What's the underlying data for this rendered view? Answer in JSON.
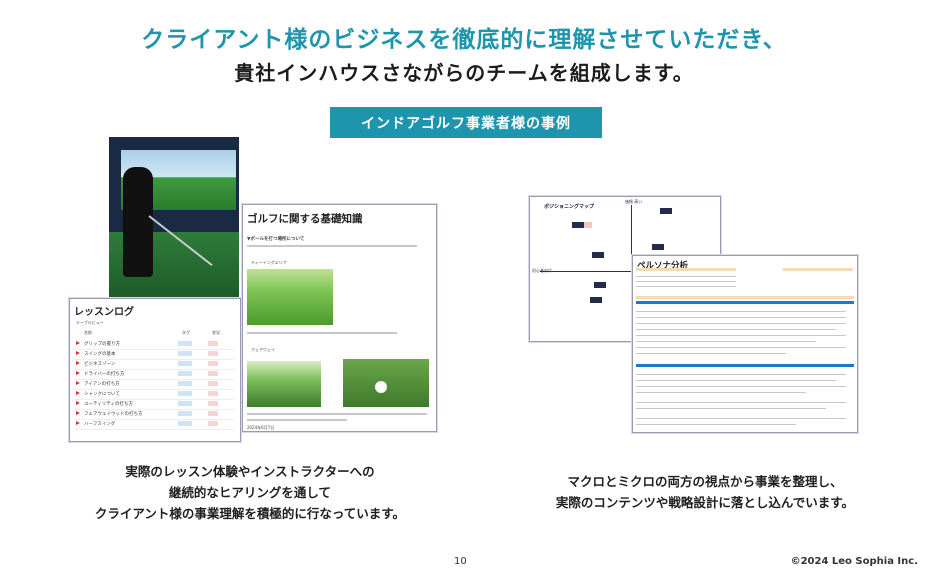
{
  "header": {
    "line1": "クライアント様のビジネスを徹底的に理解させていただき、",
    "line2": "貴社インハウスさながらのチームを組成します。"
  },
  "section_tag": "インドアゴルフ事業者様の事例",
  "left_panel": {
    "knowledge_doc": {
      "title": "ゴルフに関する基礎知識",
      "heading": "▼ボールを打つ場所について",
      "sub1": "ティーイングエリア",
      "sub2": "フェアウェイ",
      "footer": "2024年6月7日"
    },
    "lesson_log": {
      "title": "レッスンログ",
      "view": "テーブルビュー",
      "columns": [
        "名前",
        "タグ",
        "状況"
      ],
      "rows": [
        "グリップの握り方",
        "スイングの基本",
        "ビジネスゾーン",
        "ドライバーの打ち方",
        "アイアンの打ち方",
        "シャンクについて",
        "ユーティリティの打ち方",
        "フェアウェイウッドの打ち方",
        "ハーフスイング"
      ]
    },
    "caption": [
      "実際のレッスン体験やインストラクターへの",
      "継続的なヒアリングを通して",
      "クライアント様の事業理解を積極的に行なっています。"
    ]
  },
  "right_panel": {
    "positioning_map": {
      "title": "ポジショニングマップ",
      "axis_top": "価格 高い",
      "axis_left": "初心者向け"
    },
    "persona_doc": {
      "title": "ペルソナ分析"
    },
    "caption": [
      "マクロとミクロの両方の視点から事業を整理し、",
      "実際のコンテンツや戦略設計に落とし込んでいます。"
    ]
  },
  "footer": {
    "page_number": "10",
    "copyright": "©2024 Leo Sophia Inc."
  }
}
